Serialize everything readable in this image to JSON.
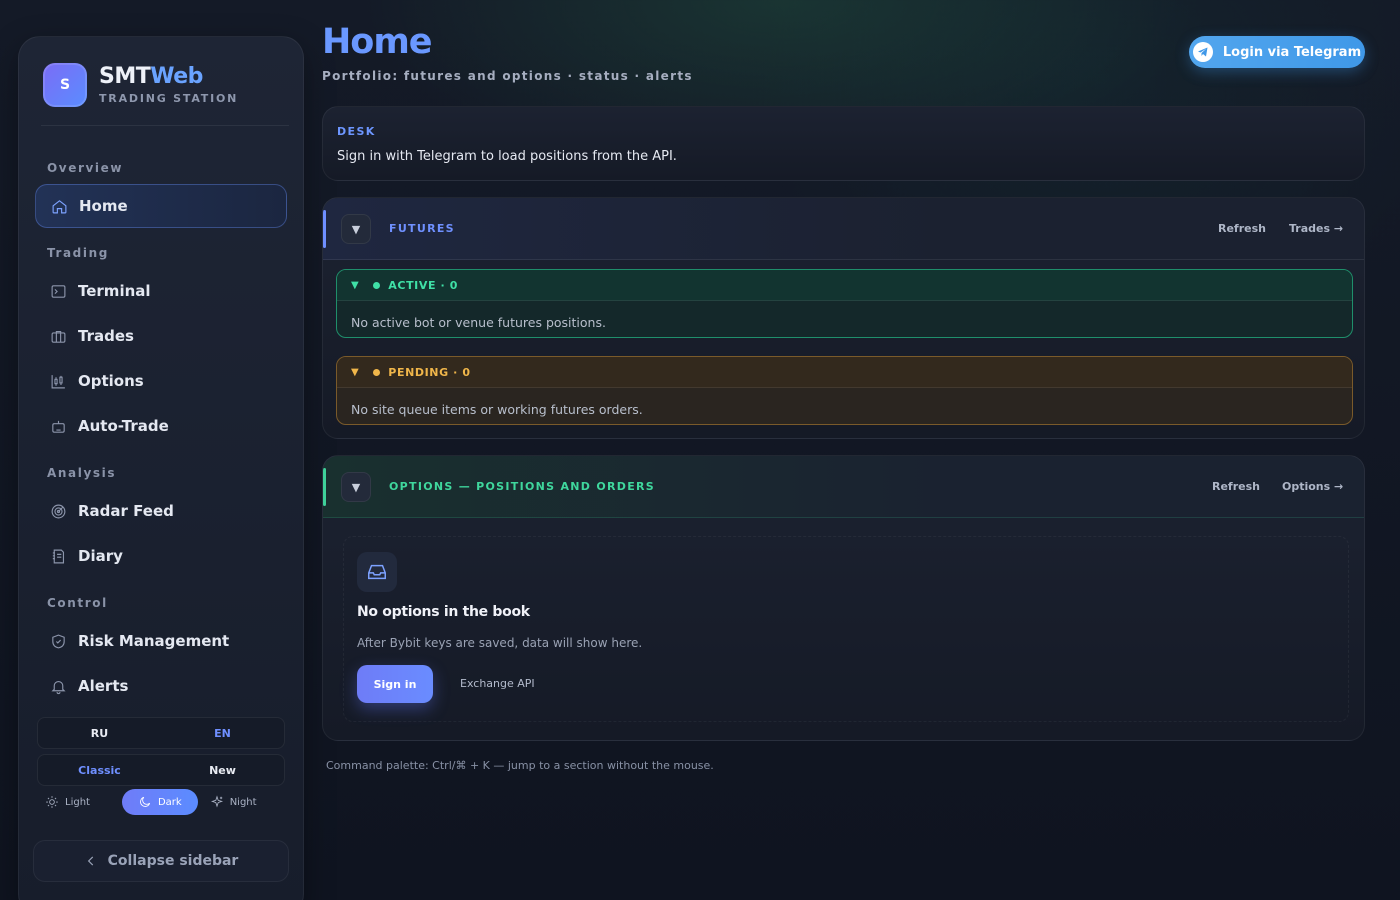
{
  "brand": {
    "logo_letter": "S",
    "name_part1": "SMT",
    "name_part2": "Web",
    "subtitle": "TRADING STATION"
  },
  "sidebar": {
    "sections": {
      "overview": "Overview",
      "trading": "Trading",
      "analysis": "Analysis",
      "control": "Control"
    },
    "items": {
      "home": "Home",
      "terminal": "Terminal",
      "trades": "Trades",
      "options": "Options",
      "autotrade": "Auto-Trade",
      "radar": "Radar Feed",
      "diary": "Diary",
      "risk": "Risk Management",
      "alerts": "Alerts"
    },
    "active_item": "Home",
    "language": {
      "ru": "RU",
      "en": "EN",
      "selected": "EN"
    },
    "layout": {
      "classic": "Classic",
      "new": "New",
      "selected": "Classic"
    },
    "theme": {
      "light": "Light",
      "dark": "Dark",
      "night": "Night",
      "selected": "Dark"
    },
    "collapse_label": "Collapse sidebar"
  },
  "header": {
    "title": "Home",
    "subtitle": "Portfolio: futures and options · status · alerts",
    "login_label": "Login via Telegram"
  },
  "desk": {
    "label": "DESK",
    "text": "Sign in with Telegram to load positions from the API."
  },
  "futures": {
    "title": "FUTURES",
    "refresh_label": "Refresh",
    "link_label": "Trades →",
    "active": {
      "label": "ACTIVE · 0",
      "empty_text": "No active bot or venue futures positions."
    },
    "pending": {
      "label": "PENDING · 0",
      "empty_text": "No site queue items or working futures orders."
    }
  },
  "options_section": {
    "title": "OPTIONS — POSITIONS AND ORDERS",
    "refresh_label": "Refresh",
    "link_label": "Options →",
    "empty_title": "No options in the book",
    "empty_desc": "After Bybit keys are saved, data will show here.",
    "signin_label": "Sign in",
    "exchange_label": "Exchange API"
  },
  "footnote": "Command palette: Ctrl/⌘ + K — jump to a section without the mouse.",
  "colors": {
    "accent": "#6a98ff",
    "success": "#3fe0a6",
    "warning": "#f0b64a",
    "telegram": "#3f98e8"
  }
}
